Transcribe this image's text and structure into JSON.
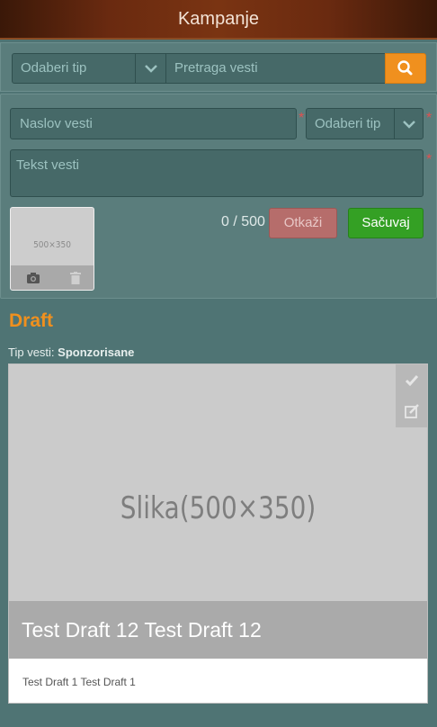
{
  "header": {
    "title": "Kampanje"
  },
  "search": {
    "type_select": "Odaberi tip",
    "input_placeholder": "Pretraga vesti"
  },
  "form": {
    "title_placeholder": "Naslov vesti",
    "type_select": "Odaberi tip",
    "text_placeholder": "Tekst vesti",
    "required_mark": "*",
    "thumbnail_label": "500×350",
    "counter": "0 / 500",
    "cancel_label": "Otkaži",
    "save_label": "Sačuvaj"
  },
  "draft": {
    "section_title": "Draft",
    "type_label": "Tip vesti:",
    "type_value": "Sponzorisane",
    "card": {
      "image_placeholder": "Slika(500×350)",
      "title": "Test Draft 12 Test Draft 12",
      "text": "Test Draft 1 Test Draft 1"
    }
  },
  "icons": [
    "chevron-down-icon",
    "search-icon",
    "camera-icon",
    "trash-icon",
    "check-icon",
    "edit-icon"
  ],
  "colors": {
    "accent": "#f0901e",
    "save": "#34a024",
    "cancel": "#b66d6b",
    "background": "#4f7474"
  }
}
